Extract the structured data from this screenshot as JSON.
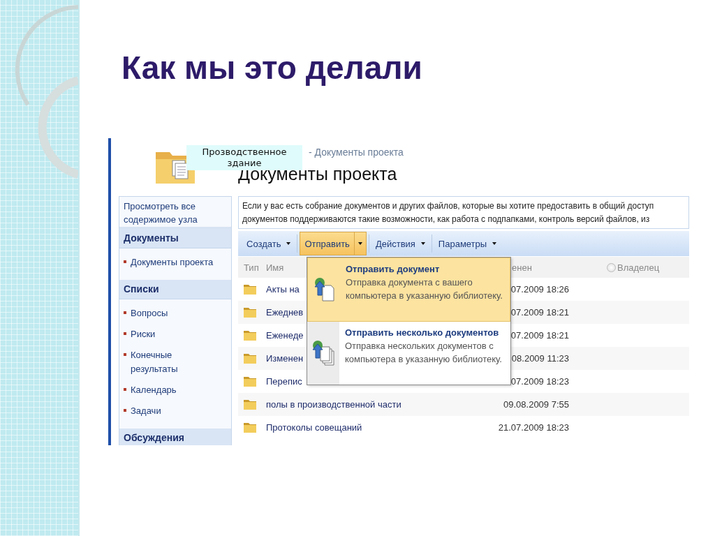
{
  "slide": {
    "title": "Как мы это делали"
  },
  "screenshot": {
    "callout": "Прозводственное здание",
    "breadcrumb": "- Документы проекта",
    "page_title": "Документы проекта",
    "sidebar": {
      "top_link": "Просмотреть все содержимое узла",
      "sections": [
        {
          "heading": "Документы",
          "items": [
            "Документы проекта"
          ]
        },
        {
          "heading": "Списки",
          "items": [
            "Вопросы",
            "Риски",
            "Конечные результаты",
            "Календарь",
            "Задачи"
          ]
        },
        {
          "heading": "Обсуждения"
        }
      ]
    },
    "description": [
      "Если у вас есть собрание документов и других файлов, которые вы хотите предоставить в общий доступ",
      "документов поддерживаются такие возможности, как работа с подпапками, контроль версий файлов, из"
    ],
    "toolbar": [
      {
        "label": "Создать",
        "selected": false
      },
      {
        "label": "Отправить",
        "selected": true
      },
      {
        "label": "Действия",
        "selected": false
      },
      {
        "label": "Параметры",
        "selected": false
      }
    ],
    "columns": [
      "Тип",
      "Имя",
      "енен",
      "Владелец"
    ],
    "rows": [
      {
        "name": "Акты на",
        "modified": "07.2009 18:26"
      },
      {
        "name": "Ежеднев",
        "modified": "07.2009 18:21"
      },
      {
        "name": "Еженеде",
        "modified": "07.2009 18:21"
      },
      {
        "name": "Изменен",
        "modified": "08.2009 11:23"
      },
      {
        "name": "Перепис",
        "modified": "07.2009 18:23"
      },
      {
        "name": "полы в производственной части",
        "modified": "09.08.2009 7:55"
      },
      {
        "name": "Протоколы совещаний",
        "modified": "21.07.2009 18:23"
      }
    ],
    "menu": [
      {
        "kind": "single",
        "title": "Отправить документ",
        "description": "Отправка документа с вашего компьютера в указанную библиотеку.",
        "selected": true
      },
      {
        "kind": "multiple",
        "title": "Отправить несколько документов",
        "description": "Отправка нескольких документов с компьютера в указанную библиотеку.",
        "selected": false
      }
    ]
  }
}
